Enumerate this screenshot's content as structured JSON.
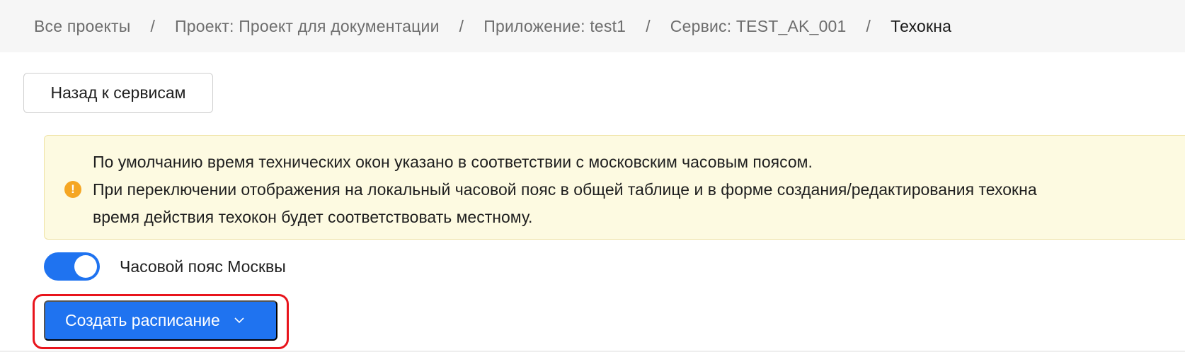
{
  "breadcrumb": {
    "items": [
      "Все проекты",
      "Проект: Проект для документации",
      "Приложение: test1",
      "Сервис: TEST_AK_001",
      "Техокна"
    ],
    "separator": "/"
  },
  "back_button": {
    "label": "Назад к сервисам"
  },
  "notice": {
    "icon": "warning-icon",
    "icon_glyph": "!",
    "lines": [
      "По умолчанию время технических окон указано в соответствии с московским часовым поясом.",
      "При переключении отображения на локальный часовой пояс в общей таблице и в форме создания/редактирования техокна",
      "время действия техокон будет соответствовать местному."
    ]
  },
  "timezone_toggle": {
    "label": "Часовой пояс Москвы",
    "checked": true
  },
  "create_button": {
    "label": "Создать расписание",
    "icon": "chevron-down-icon"
  },
  "colors": {
    "accent": "#1f73f0",
    "notice_bg": "#fdfae1",
    "warning": "#f5a623",
    "highlight": "#e8141c"
  }
}
